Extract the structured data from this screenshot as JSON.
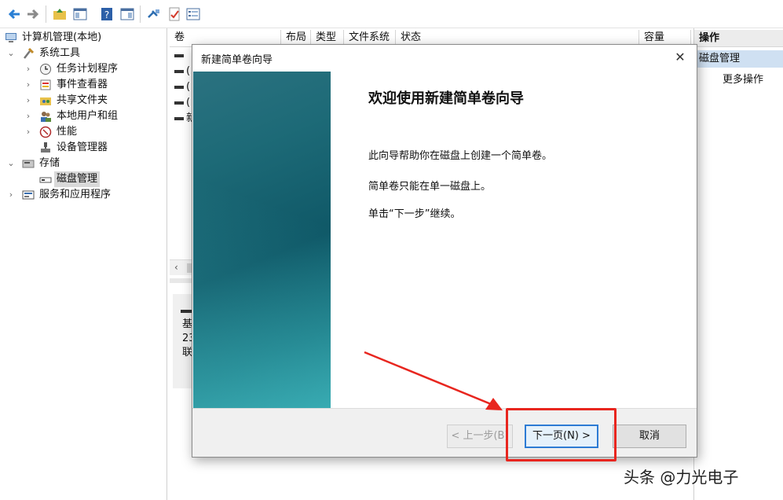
{
  "toolbar": {
    "icons": [
      "back-icon",
      "forward-icon",
      "up-folder-icon",
      "show-hide-tree-icon",
      "help-icon",
      "show-hide-action-icon",
      "connect-icon",
      "checklist-icon",
      "properties-icon"
    ]
  },
  "tree": {
    "items": [
      {
        "label": "计算机管理(本地)",
        "icon": "computer-management-icon"
      },
      {
        "label": "系统工具",
        "icon": "tools-icon",
        "expanded": true
      },
      {
        "label": "任务计划程序",
        "icon": "clock-icon"
      },
      {
        "label": "事件查看器",
        "icon": "event-viewer-icon"
      },
      {
        "label": "共享文件夹",
        "icon": "shared-folder-icon"
      },
      {
        "label": "本地用户和组",
        "icon": "users-icon"
      },
      {
        "label": "性能",
        "icon": "performance-icon"
      },
      {
        "label": "设备管理器",
        "icon": "device-manager-icon"
      },
      {
        "label": "存储",
        "icon": "storage-icon",
        "expanded": true
      },
      {
        "label": "磁盘管理",
        "icon": "disk-icon",
        "selected": true
      },
      {
        "label": "服务和应用程序",
        "icon": "services-icon"
      }
    ]
  },
  "volume_list": {
    "columns": [
      "卷",
      "布局",
      "类型",
      "文件系统",
      "状态",
      "容量"
    ],
    "rows": [
      "",
      "(",
      "(",
      "(",
      "新"
    ]
  },
  "disk_panel": {
    "lines": [
      "基",
      "23",
      "联"
    ]
  },
  "actions": {
    "header": "操作",
    "section": "磁盘管理",
    "more": "更多操作"
  },
  "dialog": {
    "title": "新建简单卷向导",
    "close": "✕",
    "heading": "欢迎使用新建简单卷向导",
    "paragraphs": [
      "此向导帮助你在磁盘上创建一个简单卷。",
      "简单卷只能在单一磁盘上。",
      "单击“下一步”继续。"
    ],
    "buttons": {
      "back": "< 上一步(B)",
      "next": "下一页(N) >",
      "cancel": "取消"
    }
  },
  "colors": {
    "highlight": "#e8261f",
    "banner": "#0f5867",
    "primary_border": "#2d7bd4"
  },
  "watermark": "头条 @力光电子"
}
